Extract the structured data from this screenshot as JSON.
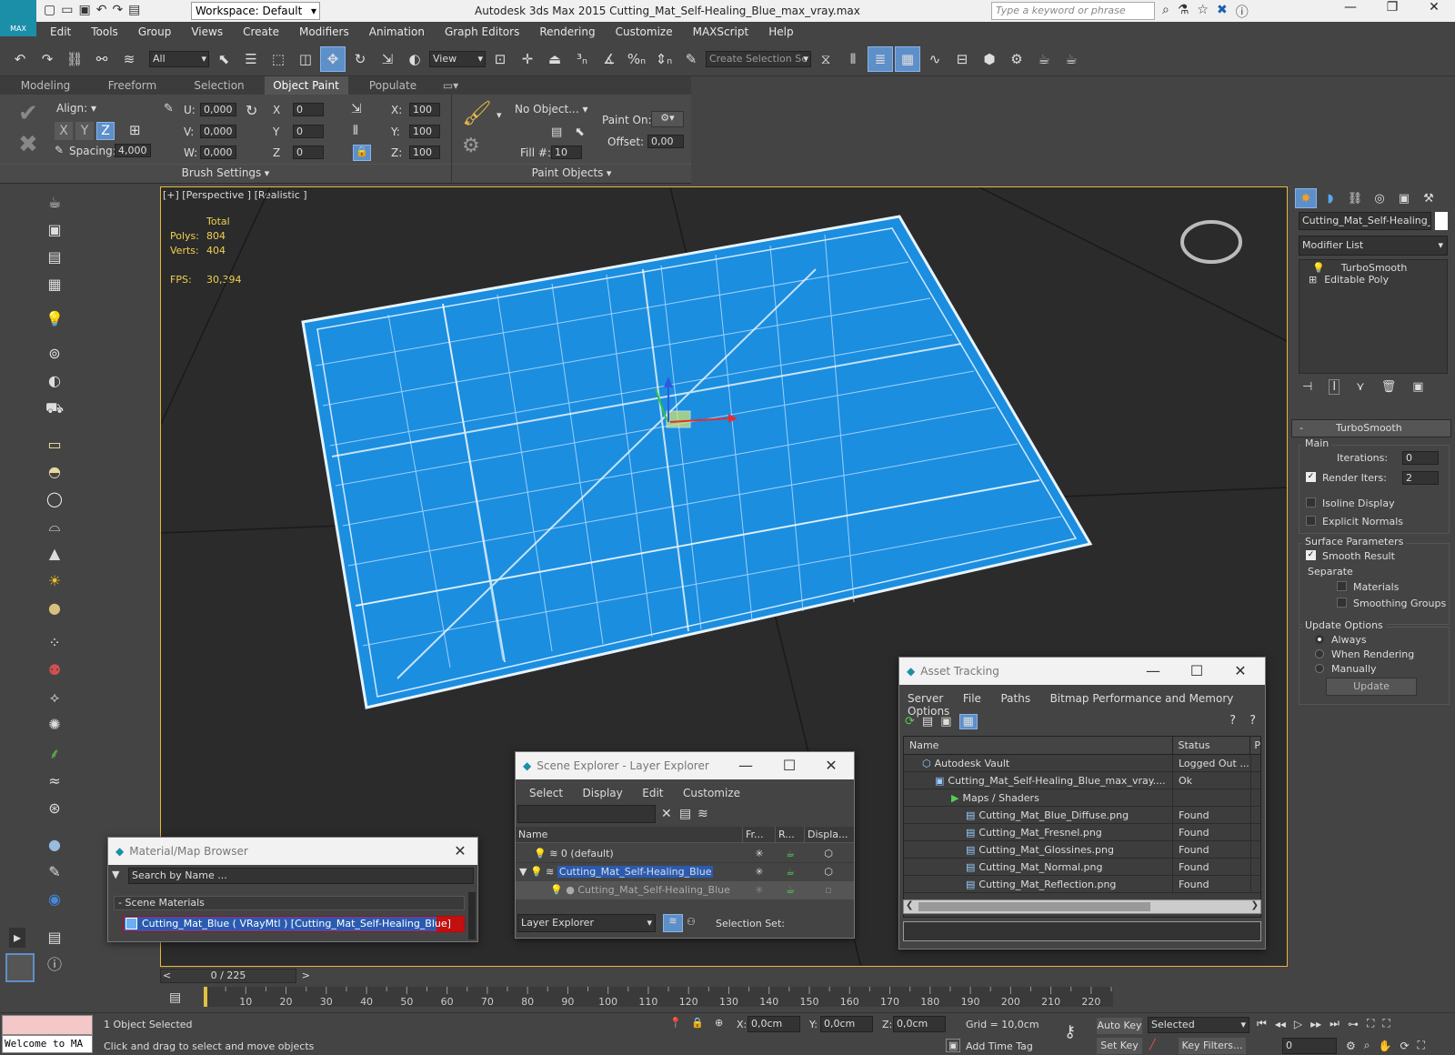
{
  "titlebar": {
    "workspace": "Workspace: Default",
    "title": "Autodesk 3ds Max  2015     Cutting_Mat_Self-Healing_Blue_max_vray.max",
    "search_placeholder": "Type a keyword or phrase",
    "logo_text": "MAX"
  },
  "menu": [
    "Edit",
    "Tools",
    "Group",
    "Views",
    "Create",
    "Modifiers",
    "Animation",
    "Graph Editors",
    "Rendering",
    "Customize",
    "MAXScript",
    "Help"
  ],
  "toolbar": {
    "filter": "All",
    "refcoord": "View",
    "selection_set": "Create Selection Se"
  },
  "ribbon": {
    "tabs": [
      "Modeling",
      "Freeform",
      "Selection",
      "Object Paint",
      "Populate"
    ],
    "align_label": "Align:",
    "x": "X",
    "y": "Y",
    "z": "Z",
    "spacing_label": "Spacing:",
    "spacing_value": "4,000",
    "u_label": "U:",
    "v_label": "V:",
    "w_label": "W:",
    "u_value": "0,000",
    "v_value": "0,000",
    "w_value": "0,000",
    "rx_label": "X",
    "ry_label": "Y",
    "rz_label": "Z",
    "rx_value": "0",
    "ry_value": "0",
    "rz_value": "0",
    "sx_label": "X:",
    "sy_label": "Y:",
    "sz_label": "Z:",
    "sx_value": "100",
    "sy_value": "100",
    "sz_value": "100",
    "brush_settings": "Brush Settings",
    "no_object": "No Object...",
    "fill_label": "Fill #:",
    "fill_value": "10",
    "paint_on": "Paint On:",
    "offset_label": "Offset:",
    "offset_value": "0,00",
    "paint_objects": "Paint Objects"
  },
  "viewport": {
    "label": "[+] [Perspective ] [Realistic ]",
    "stats_header": "Total",
    "polys_label": "Polys:",
    "polys": "804",
    "verts_label": "Verts:",
    "verts": "404",
    "fps_label": "FPS:",
    "fps": "30,394"
  },
  "command_panel": {
    "object_name": "Cutting_Mat_Self-Healing_Blu",
    "modifier_list": "Modifier List",
    "stack": [
      "TurboSmooth",
      "Editable Poly"
    ],
    "rollout_title": "TurboSmooth",
    "main_group": "Main",
    "iterations_label": "Iterations:",
    "iterations": "0",
    "render_iters_label": "Render Iters:",
    "render_iters": "2",
    "isoline": "Isoline Display",
    "explicit": "Explicit Normals",
    "surface_group": "Surface Parameters",
    "smooth_result": "Smooth Result",
    "separate": "Separate",
    "materials": "Materials",
    "smoothing_groups": "Smoothing Groups",
    "update_group": "Update Options",
    "always": "Always",
    "when_rendering": "When Rendering",
    "manually": "Manually",
    "update_button": "Update"
  },
  "asset_tracking": {
    "title": "Asset Tracking",
    "menu": [
      "Server",
      "File",
      "Paths",
      "Bitmap Performance and Memory",
      "Options"
    ],
    "col_name": "Name",
    "col_status": "Status",
    "col_extra": "P",
    "rows": [
      {
        "name": "Autodesk Vault",
        "status": "Logged Out ..."
      },
      {
        "name": "Cutting_Mat_Self-Healing_Blue_max_vray....",
        "status": "Ok"
      },
      {
        "name": "Maps / Shaders",
        "status": ""
      },
      {
        "name": "Cutting_Mat_Blue_Diffuse.png",
        "status": "Found"
      },
      {
        "name": "Cutting_Mat_Fresnel.png",
        "status": "Found"
      },
      {
        "name": "Cutting_Mat_Glossines.png",
        "status": "Found"
      },
      {
        "name": "Cutting_Mat_Normal.png",
        "status": "Found"
      },
      {
        "name": "Cutting_Mat_Reflection.png",
        "status": "Found"
      }
    ]
  },
  "scene_explorer": {
    "title": "Scene Explorer - Layer Explorer",
    "menu": [
      "Select",
      "Display",
      "Edit",
      "Customize"
    ],
    "col_name": "Name",
    "col_fr": "Fr...",
    "col_r": "R...",
    "col_disp": "Displa...",
    "rows": [
      "0 (default)",
      "Cutting_Mat_Self-Healing_Blue",
      "Cutting_Mat_Self-Healing_Blue"
    ],
    "footer_dropdown": "Layer Explorer",
    "selection_set": "Selection Set:"
  },
  "material_browser": {
    "title": "Material/Map Browser",
    "search": "Search by Name ...",
    "group": "- Scene Materials",
    "item": "Cutting_Mat_Blue  ( VRayMtl )  [Cutting_Mat_Self-Healing_Blue]"
  },
  "timeline": {
    "frame": "0 / 225",
    "ticks": [
      "10",
      "20",
      "30",
      "40",
      "50",
      "60",
      "70",
      "80",
      "90",
      "100",
      "110",
      "120",
      "130",
      "140",
      "150",
      "160",
      "170",
      "180",
      "190",
      "200",
      "210",
      "220"
    ]
  },
  "status": {
    "welcome": "Welcome to MA",
    "selected": "1 Object Selected",
    "prompt": "Click and drag to select and move objects",
    "x_label": "X:",
    "x": "0,0cm",
    "y_label": "Y:",
    "y": "0,0cm",
    "z_label": "Z:",
    "z": "0,0cm",
    "grid": "Grid = 10,0cm",
    "add_time_tag": "Add Time Tag",
    "auto_key": "Auto Key",
    "set_key": "Set Key",
    "selected_dropdown": "Selected",
    "key_filters": "Key Filters...",
    "frame_value": "0"
  },
  "colors": {
    "accent": "#5d8fc9",
    "mat_blue": "#1e8fe0",
    "highlight": "#2a5bb0"
  }
}
